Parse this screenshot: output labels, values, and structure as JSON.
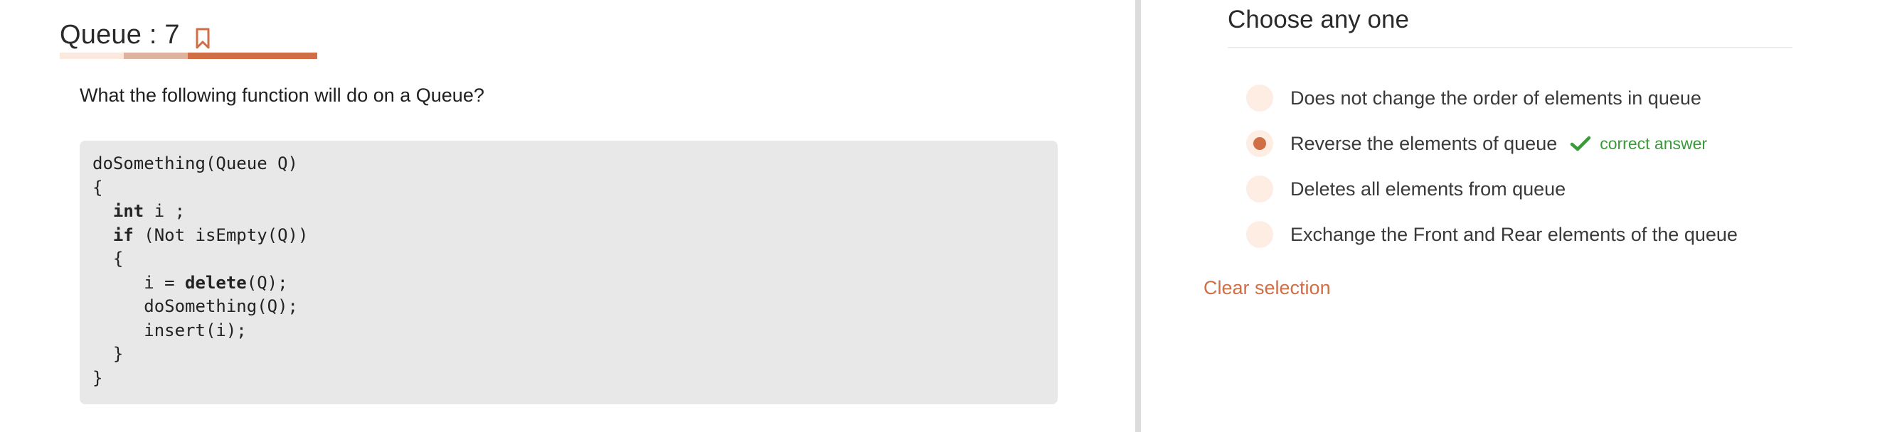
{
  "question_panel": {
    "title": "Queue : 7",
    "progress": [
      {
        "color": "#fbe9df"
      },
      {
        "color": "#ddb3a0"
      },
      {
        "color": "#d06e45"
      }
    ],
    "question_text": "What the following function will do on a Queue?",
    "code_lines": [
      "doSomething(Queue Q)",
      "{",
      "  int i ;",
      "  if (Not isEmpty(Q))",
      "  {",
      "     i = delete(Q);",
      "     doSomething(Q);",
      "     insert(i);",
      "  }",
      "}"
    ],
    "bookmark_icon": "bookmark-icon"
  },
  "answer_panel": {
    "heading": "Choose any one",
    "options": [
      {
        "label": "Does not change the order of elements in queue",
        "selected": false
      },
      {
        "label": "Reverse the elements of queue",
        "selected": true,
        "note": "correct answer"
      },
      {
        "label": "Deletes all elements from queue",
        "selected": false
      },
      {
        "label": "Exchange the Front and Rear elements of the queue",
        "selected": false
      }
    ],
    "clear_label": "Clear selection"
  },
  "colors": {
    "accent": "#d06e45",
    "radio_bg": "#fdede3",
    "correct": "#3a9a3a",
    "code_bg": "#e8e8e8"
  }
}
